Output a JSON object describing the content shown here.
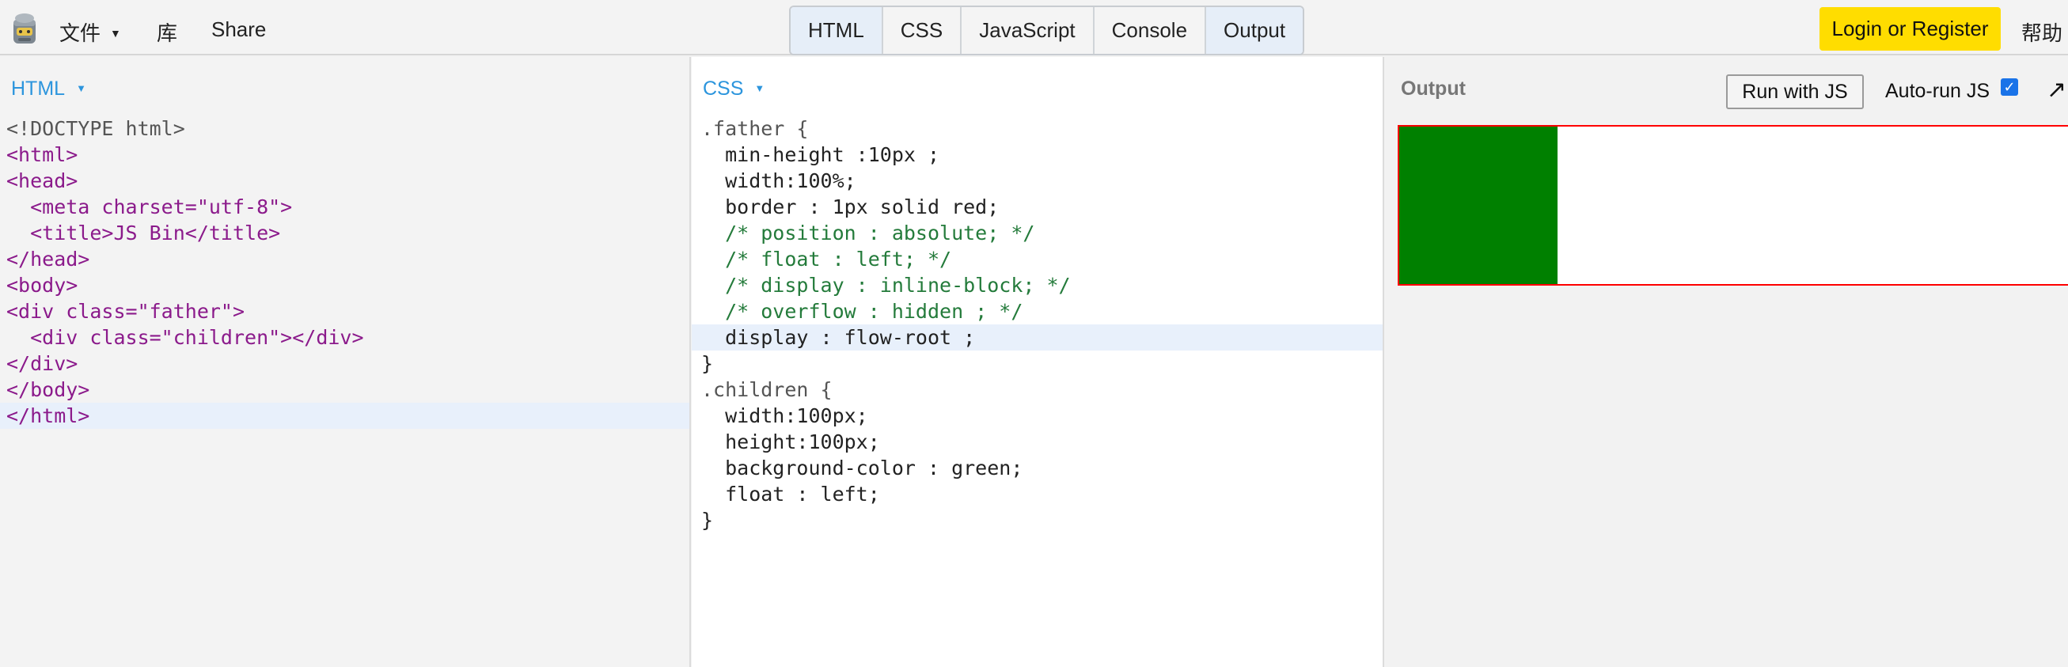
{
  "toolbar": {
    "logo_icon": "jsbin-logo-icon",
    "file_label": "文件",
    "library_label": "库",
    "share_label": "Share",
    "panels": [
      {
        "label": "HTML",
        "active": true
      },
      {
        "label": "CSS",
        "active": false
      },
      {
        "label": "JavaScript",
        "active": false
      },
      {
        "label": "Console",
        "active": false
      },
      {
        "label": "Output",
        "active": true
      }
    ],
    "login_label": "Login or Register",
    "help_label": "帮助"
  },
  "html_panel": {
    "label": "HTML",
    "lines": [
      "<!DOCTYPE html>",
      "<html>",
      "<head>",
      "  <meta charset=\"utf-8\">",
      "  <title>JS Bin</title>",
      "</head>",
      "<body>",
      "<div class=\"father\">",
      "  <div class=\"children\"></div>",
      "</div>",
      "</body>",
      "</html>"
    ]
  },
  "css_panel": {
    "label": "CSS",
    "lines": [
      ".father {",
      "  min-height :10px ;",
      "  width:100%;",
      "  border : 1px solid red;",
      "  /* position : absolute; */",
      "  /* float : left; */",
      "  /* display : inline-block; */",
      "  /* overflow : hidden ; */",
      "  display : flow-root ;",
      "}",
      ".children {",
      "  width:100px;",
      "  height:100px;",
      "  background-color : green;",
      "  float : left;",
      "}"
    ]
  },
  "output_panel": {
    "label": "Output",
    "run_label": "Run with JS",
    "autorun_label": "Auto-run JS",
    "autorun_checked": true,
    "popout_icon": "popout-arrow-icon",
    "father_border_color": "#ff0000",
    "child_color": "#008000"
  },
  "colors": {
    "accent_blue": "#2c95dd",
    "login_yellow": "#ffdd00"
  }
}
